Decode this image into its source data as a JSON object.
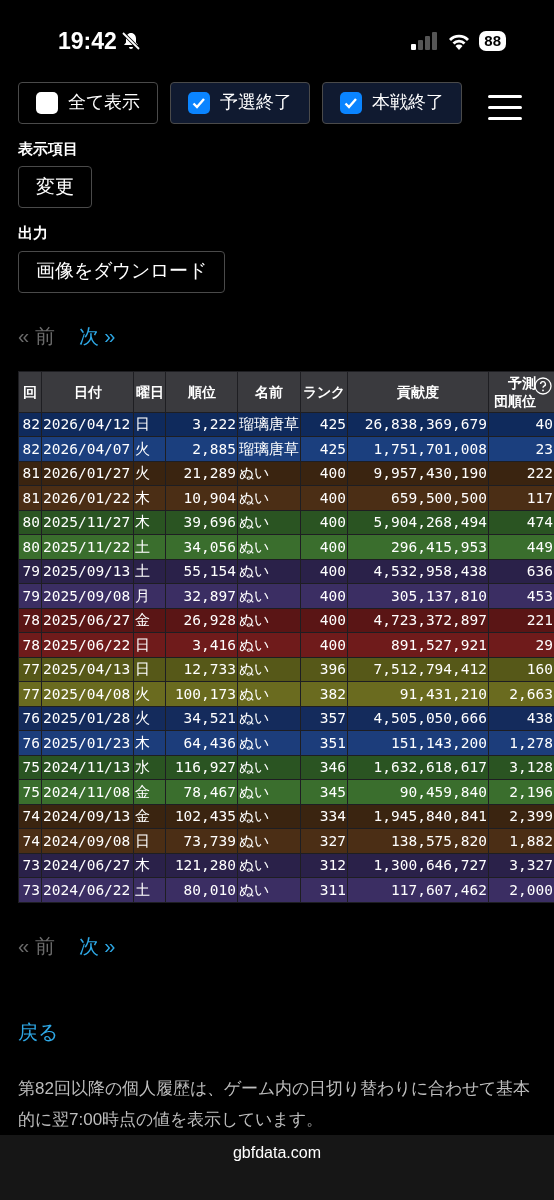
{
  "status_bar": {
    "time": "19:42",
    "battery": "88"
  },
  "filters": [
    {
      "label": "全て表示",
      "checked": false
    },
    {
      "label": "予選終了",
      "checked": true
    },
    {
      "label": "本戦終了",
      "checked": true
    }
  ],
  "display_items": {
    "label": "表示項目",
    "button": "変更"
  },
  "output": {
    "label": "出力",
    "button": "画像をダウンロード"
  },
  "pagination_top": [
    {
      "label": "« 前",
      "disabled": true
    },
    {
      "label": "次 »",
      "disabled": false
    }
  ],
  "table": {
    "columns": [
      "回",
      "日付",
      "曜日",
      "順位",
      "名前",
      "ランク",
      "貢献度",
      "予測団順位"
    ],
    "rows": [
      {
        "color": "#0f2a5c",
        "cells": [
          "82",
          "2026/04/12",
          "日",
          "3,222",
          "瑠璃唐草",
          "425",
          "26,838,369,679",
          "40"
        ]
      },
      {
        "color": "#1b3f7e",
        "cells": [
          "82",
          "2026/04/07",
          "火",
          "2,885",
          "瑠璃唐草",
          "425",
          "1,751,701,008",
          "23"
        ]
      },
      {
        "color": "#3a2410",
        "cells": [
          "81",
          "2026/01/27",
          "火",
          "21,289",
          "ぬい",
          "400",
          "9,957,430,190",
          "222"
        ]
      },
      {
        "color": "#4b2e15",
        "cells": [
          "81",
          "2026/01/22",
          "木",
          "10,904",
          "ぬい",
          "400",
          "659,500,500",
          "117"
        ]
      },
      {
        "color": "#2a5422",
        "cells": [
          "80",
          "2025/11/27",
          "木",
          "39,696",
          "ぬい",
          "400",
          "5,904,268,494",
          "474"
        ]
      },
      {
        "color": "#3a6e2d",
        "cells": [
          "80",
          "2025/11/22",
          "土",
          "34,056",
          "ぬい",
          "400",
          "296,415,953",
          "449"
        ]
      },
      {
        "color": "#2a2149",
        "cells": [
          "79",
          "2025/09/13",
          "土",
          "55,154",
          "ぬい",
          "400",
          "4,532,958,438",
          "636"
        ]
      },
      {
        "color": "#3b2e63",
        "cells": [
          "79",
          "2025/09/08",
          "月",
          "32,897",
          "ぬい",
          "400",
          "305,137,810",
          "453"
        ]
      },
      {
        "color": "#5a1515",
        "cells": [
          "78",
          "2025/06/27",
          "金",
          "26,928",
          "ぬい",
          "400",
          "4,723,372,897",
          "221"
        ]
      },
      {
        "color": "#6f1b1b",
        "cells": [
          "78",
          "2025/06/22",
          "日",
          "3,416",
          "ぬい",
          "400",
          "891,527,921",
          "29"
        ]
      },
      {
        "color": "#565818",
        "cells": [
          "77",
          "2025/04/13",
          "日",
          "12,733",
          "ぬい",
          "396",
          "7,512,794,412",
          "160"
        ]
      },
      {
        "color": "#6a6b1f",
        "cells": [
          "77",
          "2025/04/08",
          "火",
          "100,173",
          "ぬい",
          "382",
          "91,431,210",
          "2,663"
        ]
      },
      {
        "color": "#142b5c",
        "cells": [
          "76",
          "2025/01/28",
          "火",
          "34,521",
          "ぬい",
          "357",
          "4,505,050,666",
          "438"
        ]
      },
      {
        "color": "#1c3d7b",
        "cells": [
          "76",
          "2025/01/23",
          "木",
          "64,436",
          "ぬい",
          "351",
          "151,143,200",
          "1,278"
        ]
      },
      {
        "color": "#2a5422",
        "cells": [
          "75",
          "2024/11/13",
          "水",
          "116,927",
          "ぬい",
          "346",
          "1,632,618,617",
          "3,128"
        ]
      },
      {
        "color": "#3a6e2d",
        "cells": [
          "75",
          "2024/11/08",
          "金",
          "78,467",
          "ぬい",
          "345",
          "90,459,840",
          "2,196"
        ]
      },
      {
        "color": "#3a2410",
        "cells": [
          "74",
          "2024/09/13",
          "金",
          "102,435",
          "ぬい",
          "334",
          "1,945,840,841",
          "2,399"
        ]
      },
      {
        "color": "#4b2e15",
        "cells": [
          "74",
          "2024/09/08",
          "日",
          "73,739",
          "ぬい",
          "327",
          "138,575,820",
          "1,882"
        ]
      },
      {
        "color": "#2a2149",
        "cells": [
          "73",
          "2024/06/27",
          "木",
          "121,280",
          "ぬい",
          "312",
          "1,300,646,727",
          "3,327"
        ]
      },
      {
        "color": "#3b2e63",
        "cells": [
          "73",
          "2024/06/22",
          "土",
          "80,010",
          "ぬい",
          "311",
          "117,607,462",
          "2,000"
        ]
      }
    ]
  },
  "pagination_bottom": [
    {
      "label": "« 前",
      "disabled": true
    },
    {
      "label": "次 »",
      "disabled": false
    }
  ],
  "back_link": "戻る",
  "note": "第82回以降の個人履歴は、ゲーム内の日切り替わりに合わせて基本的に翌7:00時点の値を表示しています。",
  "browser_bar": {
    "url": "gbfdata.com"
  }
}
